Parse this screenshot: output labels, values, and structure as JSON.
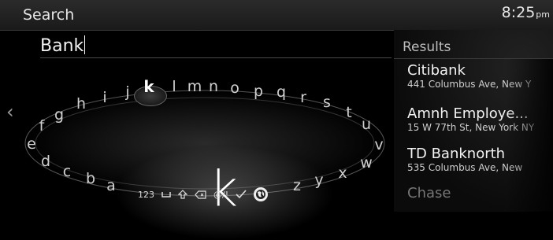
{
  "header": {
    "title": "Search",
    "time": "8:25",
    "ampm": "pm"
  },
  "search": {
    "query": "Bank"
  },
  "keyboard": {
    "selected_letter": "k",
    "letters": [
      "a",
      "b",
      "c",
      "d",
      "e",
      "f",
      "g",
      "h",
      "i",
      "j",
      "k",
      "l",
      "m",
      "n",
      "o",
      "p",
      "q",
      "r",
      "s",
      "t",
      "u",
      "v",
      "w",
      "x",
      "y",
      "z"
    ],
    "function_keys": {
      "numbers": "123",
      "symbols": "@/!"
    }
  },
  "results": {
    "header": "Results",
    "items": [
      {
        "name": "Citibank",
        "address": "441 Columbus Ave, New Y"
      },
      {
        "name": "Amnh Employe...",
        "address": "15 W 77th St, New York NY"
      },
      {
        "name": "TD Banknorth",
        "address": "535 Columbus Ave, New"
      },
      {
        "name": "Chase",
        "address": ""
      }
    ]
  },
  "icons": {
    "back": "chevron-left-icon",
    "space": "space-icon",
    "shift": "shift-icon",
    "delete": "backspace-icon",
    "confirm": "checkmark-icon",
    "language": "globe-icon"
  }
}
